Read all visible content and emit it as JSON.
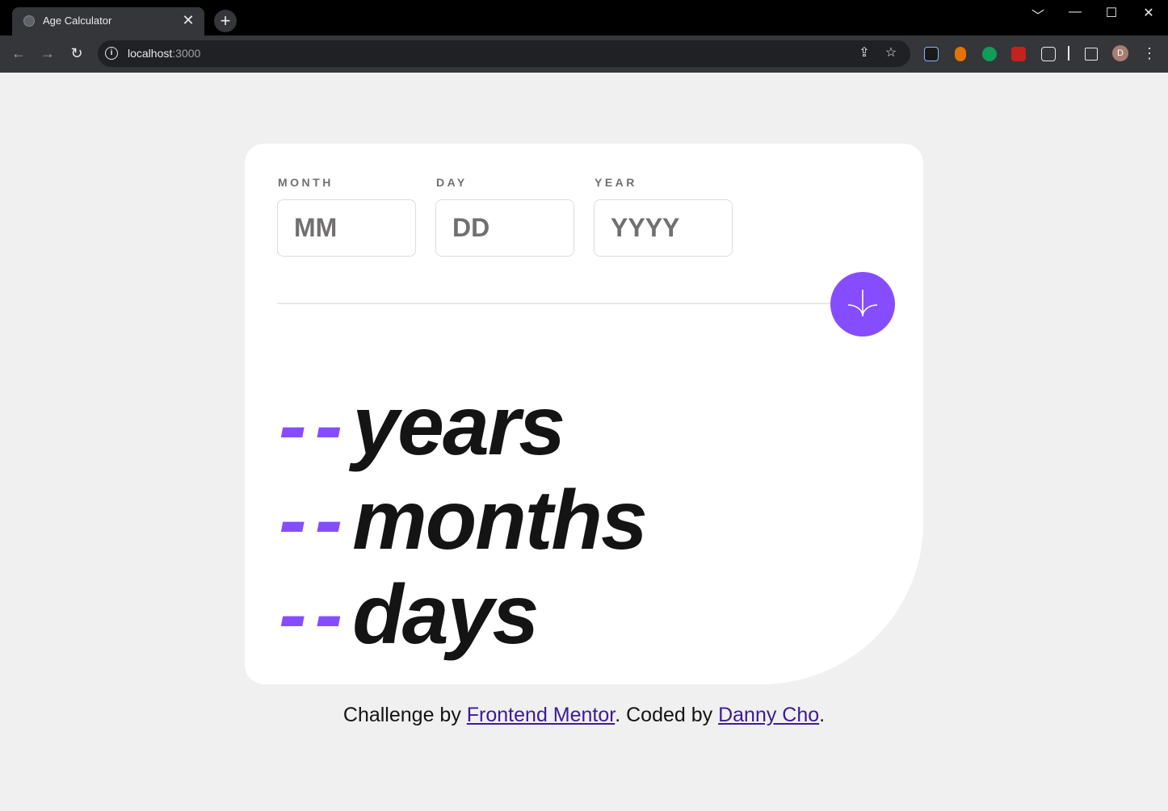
{
  "browser": {
    "tab_title": "Age Calculator",
    "tab_close": "✕",
    "new_tab": "+",
    "url_host": "localhost",
    "url_port": ":3000",
    "window_controls": [
      "﹀",
      "—",
      "☐",
      "✕"
    ],
    "profile_initial": "D"
  },
  "form": {
    "month": {
      "label": "MONTH",
      "placeholder": "MM",
      "value": ""
    },
    "day": {
      "label": "DAY",
      "placeholder": "DD",
      "value": ""
    },
    "year": {
      "label": "YEAR",
      "placeholder": "YYYY",
      "value": ""
    }
  },
  "results": [
    {
      "value": "--",
      "unit": "years"
    },
    {
      "value": "--",
      "unit": "months"
    },
    {
      "value": "--",
      "unit": "days"
    }
  ],
  "footer": {
    "prefix": "Challenge by ",
    "link1": "Frontend Mentor",
    "middle": ". Coded by ",
    "link2": "Danny Cho",
    "suffix": "."
  },
  "colors": {
    "accent": "#854dff",
    "text": "#141414",
    "label": "#716f6f",
    "background": "#f0f0f0",
    "link": "#3e1a95"
  }
}
